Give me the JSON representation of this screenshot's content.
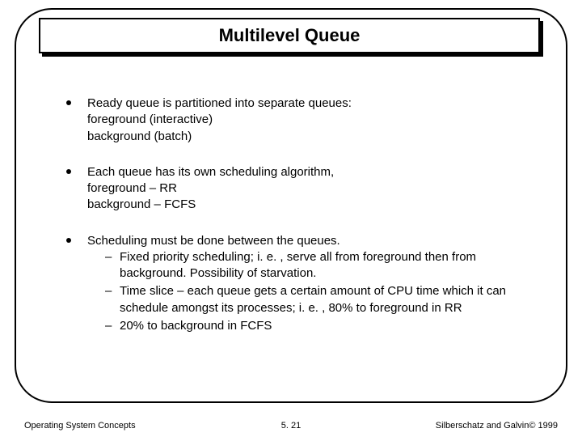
{
  "title": "Multilevel Queue",
  "bullets": [
    {
      "head": "Ready queue is partitioned into separate queues:",
      "lines": [
        "foreground (interactive)",
        "background (batch)"
      ]
    },
    {
      "head": "Each queue has its own scheduling algorithm,",
      "lines": [
        "foreground – RR",
        "background – FCFS"
      ]
    },
    {
      "head": "Scheduling must be done between the queues.",
      "dashes": [
        "Fixed priority scheduling; i. e. , serve all from foreground then from background.  Possibility of starvation.",
        "Time slice – each queue gets a certain amount of CPU time which it can schedule amongst its processes; i. e. , 80% to foreground in RR",
        "20% to background in FCFS"
      ]
    }
  ],
  "footer": {
    "left": "Operating System Concepts",
    "center": "5. 21",
    "right": "Silberschatz and Galvin© 1999"
  }
}
